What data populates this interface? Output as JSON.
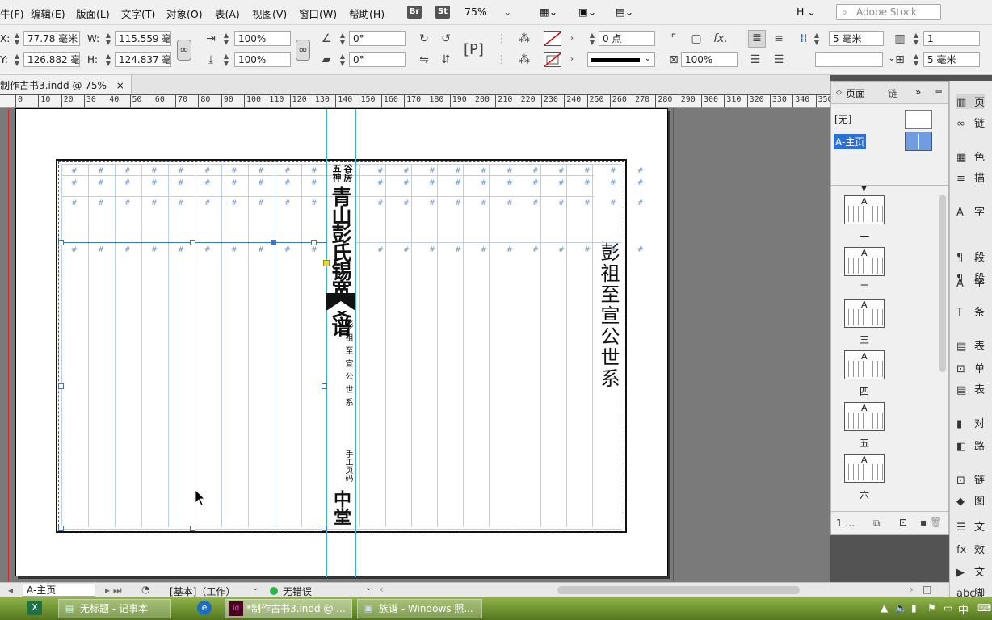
{
  "menubar": {
    "items": [
      "牛(F)",
      "编辑(E)",
      "版面(L)",
      "文字(T)",
      "对象(O)",
      "表(A)",
      "视图(V)",
      "窗口(W)",
      "帮助(H)"
    ],
    "br": "Br",
    "st": "St",
    "zoom": "75%",
    "h_label": "H",
    "search_placeholder": "Adobe Stock"
  },
  "control": {
    "x_label": "X:",
    "x_value": "77.78 毫米",
    "y_label": "Y:",
    "y_value": "126.882 毫",
    "w_label": "W:",
    "w_value": "115.559 毫",
    "h_label": "H:",
    "h_value": "124.837 毫",
    "scale_x": "100%",
    "scale_y": "100%",
    "angle": "0°",
    "shear": "0°",
    "stroke_weight": "0 点",
    "opacity": "100%",
    "gutter": "5 毫米",
    "columns": "1",
    "gutter2": "5 毫米"
  },
  "doctab": {
    "title": "制作古书3.indd @ 75%"
  },
  "ruler": {
    "ticks": [
      "0",
      "10",
      "20",
      "30",
      "40",
      "50",
      "60",
      "70",
      "80",
      "90",
      "100",
      "110",
      "120",
      "130",
      "140",
      "150",
      "160",
      "170",
      "180",
      "190",
      "200",
      "210",
      "220",
      "230",
      "240",
      "250",
      "260",
      "270",
      "280",
      "290",
      "300",
      "310",
      "320",
      "330",
      "340",
      "350"
    ]
  },
  "spread": {
    "spine_top_small_l": "五神",
    "spine_top_small_r": "谷房",
    "spine_title": "青山彭氏锡宽支谱",
    "spine_sub": "彭祖至宣公世系",
    "spine_page": "手工页码",
    "spine_bottom": "中堂",
    "right_title": "彭祖至宣公世系"
  },
  "status": {
    "master": "A-主页",
    "preflight_profile": "[基本]（工作）",
    "errors": "无错误"
  },
  "pages_panel": {
    "tab_pages": "页面",
    "tab_links": "链",
    "none": "[无]",
    "master": "A-主页",
    "pages": [
      "一",
      "二",
      "三",
      "四",
      "五",
      "六"
    ],
    "footer": "1 ..."
  },
  "dock": {
    "items": [
      "页",
      "链",
      "色",
      "描",
      "字",
      "段",
      "字",
      "段",
      "条",
      "表",
      "单",
      "表",
      "对",
      "路",
      "链",
      "图",
      "文",
      "效",
      "文",
      "脚"
    ]
  },
  "taskbar": {
    "notepad": "无标题 - 记事本",
    "indesign": "*制作古书3.indd @ ...",
    "photos": "族谱 - Windows 照...",
    "ime": "中"
  }
}
